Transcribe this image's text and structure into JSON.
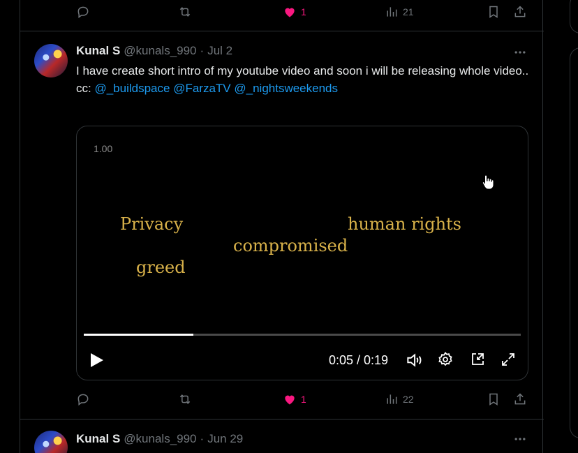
{
  "prev_tweet": {
    "actions": {
      "reply": "",
      "retweet": "",
      "likes": "1",
      "views": "21"
    }
  },
  "tweet": {
    "name": "Kunal S",
    "handle": "@kunals_990",
    "separator": "·",
    "date": "Jul 2",
    "line1": "I have create  short intro of my youtube video and soon i will be releasing whole video..",
    "cc_prefix": "cc:",
    "mentions": [
      "@_buildspace",
      "@FarzaTV",
      "@_nightsweekends"
    ],
    "video": {
      "speed_label": "1.00",
      "words": [
        "Privacy",
        "human rights",
        "compromised",
        "greed"
      ],
      "time": "0:05 / 0:19",
      "progress": 0.25
    },
    "actions": {
      "likes": "1",
      "views": "22"
    }
  },
  "next_tweet": {
    "name": "Kunal S",
    "handle": "@kunals_990",
    "separator": "·",
    "date": "Jun 29"
  },
  "colors": {
    "like": "#f91880",
    "mention": "#1d9bf0",
    "muted": "#71767b",
    "video_text": "#d9b24a"
  }
}
